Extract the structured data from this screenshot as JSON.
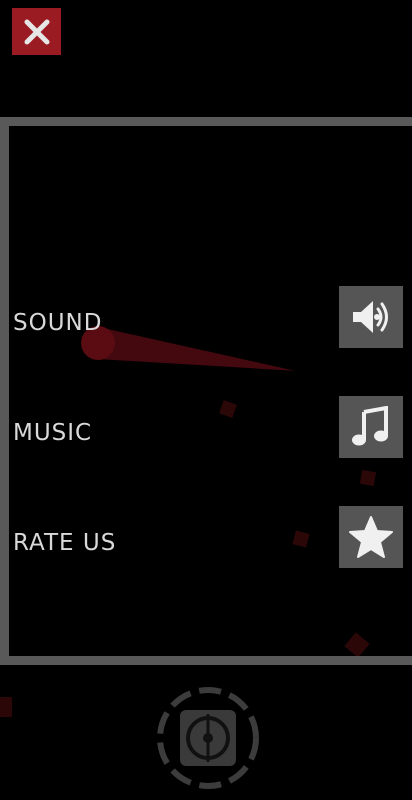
{
  "header": {
    "close_icon": "close-x-icon",
    "close_color": "#9a1b21"
  },
  "menu": {
    "items": [
      {
        "label": "SOUND",
        "icon": "speaker-icon"
      },
      {
        "label": "MUSIC",
        "icon": "music-note-icon"
      },
      {
        "label": "RATE US",
        "icon": "star-icon"
      }
    ]
  },
  "footer": {
    "control_icon": "gamepad-dial-icon"
  },
  "colors": {
    "panel_border": "#595959",
    "button_bg": "#555555",
    "label_text": "#d9d9d9",
    "accent_red": "#9a1b21"
  }
}
